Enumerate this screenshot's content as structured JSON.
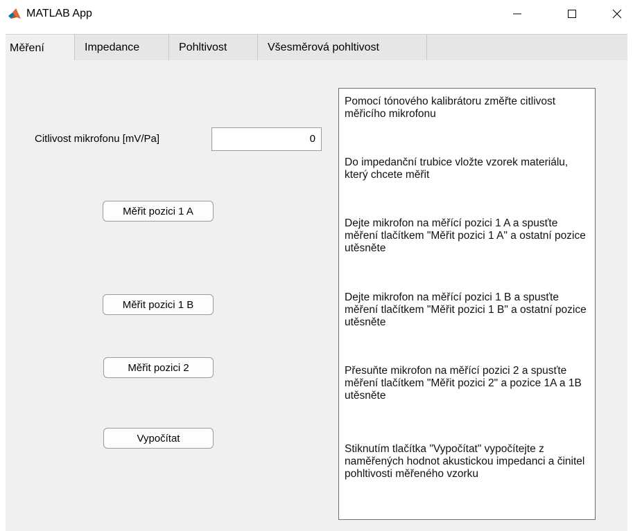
{
  "window": {
    "title": "MATLAB App",
    "icons": {
      "app": "matlab-logo-icon",
      "minimize": "minimize-icon",
      "maximize": "maximize-icon",
      "close": "close-icon"
    }
  },
  "tabs": [
    {
      "label": "Měření",
      "active": true
    },
    {
      "label": "Impedance",
      "active": false
    },
    {
      "label": "Pohltivost",
      "active": false
    },
    {
      "label": "Všesměrová pohltivost",
      "active": false
    }
  ],
  "form": {
    "sensitivity_label": "Citlivost mikrofonu [mV/Pa]",
    "sensitivity_value": "0"
  },
  "buttons": {
    "measure_1a": "Měřit pozici 1 A",
    "measure_1b": "Měřit pozici 1 B",
    "measure_2": "Měřit pozici 2",
    "calculate": "Vypočítat"
  },
  "instructions": [
    "Pomocí tónového kalibrátoru změřte citlivost měřicího mikrofonu",
    "Do impedanční trubice vložte vzorek materiálu, který chcete měřit",
    "Dejte mikrofon na měřící pozici 1 A a spusťte měření tlačítkem \"Měřit pozici 1 A\" a ostatní pozice utěsněte",
    "Dejte mikrofon na měřící pozici 1 B a spusťte měření tlačítkem \"Měřit pozici 1 B\" a ostatní pozice utěsněte",
    "Přesuňte mikrofon na měřící pozici 2 a spusťte měření tlačítkem \"Měřit pozici 2\" a pozice 1A a 1B utěsněte",
    "Stiknutím tlačítka \"Vypočítat\" vypočítejte z naměřených hodnot akustickou impedanci a činitel pohltivosti měřeného vzorku"
  ],
  "colors": {
    "panel_bg": "#f0f0f0",
    "tab_strip_bg": "#e6e6e6",
    "matlab_orange": "#e16737",
    "matlab_blue": "#0076a8"
  }
}
